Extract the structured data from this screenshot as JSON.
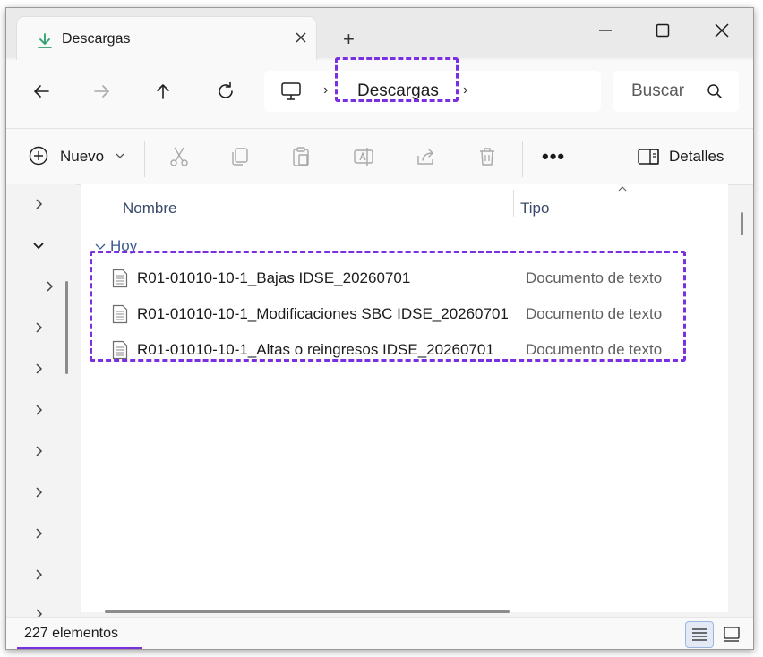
{
  "window": {
    "tab_title": "Descargas",
    "new_tab_symbol": "+"
  },
  "address": {
    "crumb": "Descargas",
    "separator": "›"
  },
  "search": {
    "placeholder": "Buscar"
  },
  "command_bar": {
    "new_label": "Nuevo",
    "more_label": "•••",
    "details_label": "Detalles"
  },
  "columns": {
    "name": "Nombre",
    "type": "Tipo"
  },
  "group": {
    "label": "Hoy"
  },
  "files": [
    {
      "name": "R01-01010-10-1_Bajas IDSE_20260701",
      "type": "Documento de texto"
    },
    {
      "name": "R01-01010-10-1_Modificaciones SBC IDSE_20260701",
      "type": "Documento de texto"
    },
    {
      "name": "R01-01010-10-1_Altas o reingresos IDSE_20260701",
      "type": "Documento de texto"
    }
  ],
  "status": {
    "item_count": "227 elementos"
  },
  "colors": {
    "accent": "#7a2fe0",
    "download_icon": "#2aa06a",
    "group_label": "#3d5a94"
  }
}
